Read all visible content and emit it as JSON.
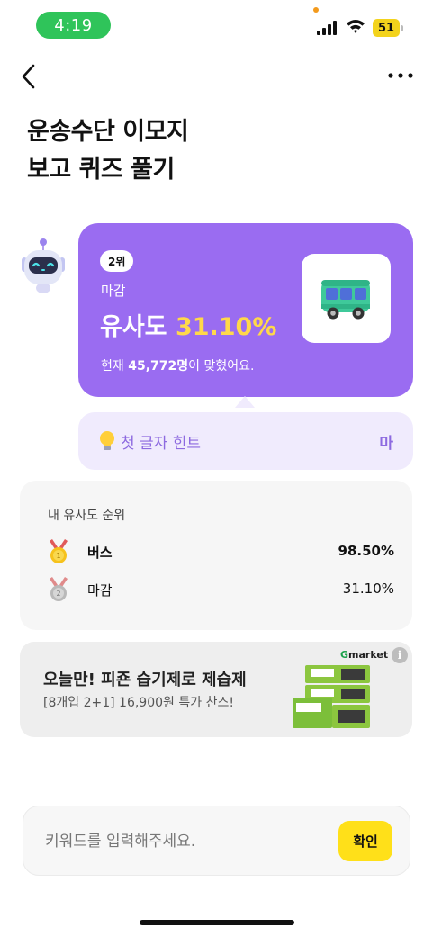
{
  "status_bar": {
    "time": "4:19",
    "battery": "51",
    "time_pill_color": "#2fc45a",
    "battery_color": "#f3d31c",
    "icons": [
      "signal-icon",
      "wifi-icon",
      "battery-icon"
    ]
  },
  "nav": {
    "back_icon": "chevron-left-icon",
    "more_icon": "more-horizontal-icon"
  },
  "page": {
    "title_line1": "운송수단 이모지",
    "title_line2": "보고 퀴즈 풀기"
  },
  "result_card": {
    "rank_badge": "2위",
    "guess": "마감",
    "similarity_label": "유사도",
    "similarity_value": "31.10%",
    "solvers_prefix": "현재",
    "solvers_count": "45,772명",
    "solvers_suffix": "이 맞혔어요.",
    "emoji_icon": "bus-icon",
    "card_color": "#9a6cf1",
    "highlight_color": "#ffd84a"
  },
  "hint": {
    "label": "첫 글자 힌트",
    "value": "마",
    "icon": "lightbulb-icon"
  },
  "ranking": {
    "title": "내 유사도 순위",
    "rows": [
      {
        "medal": "gold-medal-icon",
        "word": "버스",
        "score": "98.50%"
      },
      {
        "medal": "silver-medal-icon",
        "word": "마감",
        "score": "31.10%"
      }
    ]
  },
  "ad": {
    "brand": "Gmarket",
    "title": "오늘만! 피죤 습기제로 제습제",
    "subtitle": "[8개입 2+1] 16,900원 특가 찬스!",
    "info": "i",
    "product_icon": "product-image"
  },
  "input": {
    "placeholder": "키워드를 입력해주세요.",
    "value": "",
    "confirm_label": "확인",
    "confirm_color": "#ffe019"
  }
}
